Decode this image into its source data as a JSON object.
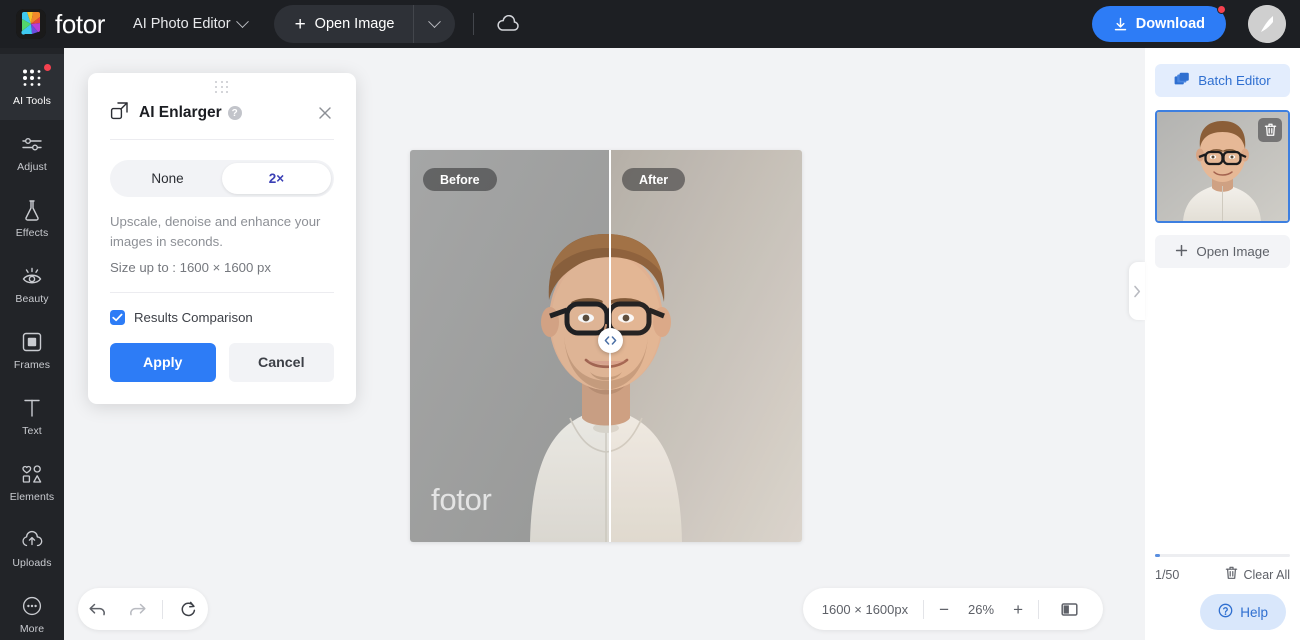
{
  "header": {
    "brand": "fotor",
    "brand_logo_icon": "fotor-pinwheel-logo",
    "app_switcher_label": "AI Photo Editor",
    "app_switcher_icon": "chevron-down-icon",
    "open_image_label": "Open Image",
    "open_image_plus_icon": "plus-icon",
    "open_image_caret_icon": "chevron-down-icon",
    "cloud_icon": "cloud-icon",
    "download_label": "Download",
    "download_icon": "download-icon",
    "download_badge_color": "#f5414f",
    "accent_color": "#2d7cf6",
    "avatar_icon": "user-avatar"
  },
  "sidebar": {
    "items": [
      {
        "label": "AI Tools",
        "icon": "ai-tools-dots-icon",
        "active": true,
        "badge": true
      },
      {
        "label": "Adjust",
        "icon": "sliders-icon",
        "active": false,
        "badge": false
      },
      {
        "label": "Effects",
        "icon": "flask-icon",
        "active": false,
        "badge": false
      },
      {
        "label": "Beauty",
        "icon": "eye-icon",
        "active": false,
        "badge": false
      },
      {
        "label": "Frames",
        "icon": "frame-square-icon",
        "active": false,
        "badge": false
      },
      {
        "label": "Text",
        "icon": "text-t-icon",
        "active": false,
        "badge": false
      },
      {
        "label": "Elements",
        "icon": "shapes-icon",
        "active": false,
        "badge": false
      },
      {
        "label": "Uploads",
        "icon": "upload-cloud-icon",
        "active": false,
        "badge": false
      },
      {
        "label": "More",
        "icon": "more-dots-icon",
        "active": false,
        "badge": false
      }
    ]
  },
  "panel": {
    "title": "AI Enlarger",
    "title_icon": "enlarge-icon",
    "help_icon": "?",
    "close_icon": "close-icon",
    "drag_handle_icon": "drag-dots-icon",
    "options": [
      {
        "label": "None",
        "selected": false
      },
      {
        "label": "2×",
        "selected": true
      }
    ],
    "description": "Upscale, denoise and enhance your images in seconds.",
    "size_note": "Size up to : 1600 × 1600 px",
    "comparison_label": "Results Comparison",
    "comparison_checked": true,
    "checkbox_icon": "checkmark-icon",
    "apply_label": "Apply",
    "cancel_label": "Cancel"
  },
  "canvas": {
    "before_label": "Before",
    "after_label": "After",
    "watermark": "fotor",
    "slider_icon": "left-right-chevrons-icon",
    "split_position_pct": 51
  },
  "bottom_bar": {
    "undo_icon": "undo-arrow-icon",
    "redo_icon": "redo-arrow-icon",
    "reset_icon": "reset-circular-arrow-icon",
    "image_size": "1600 × 1600px",
    "zoom_out_icon": "minus-icon",
    "zoom_level": "26%",
    "zoom_in_icon": "plus-icon",
    "compare_view_icon": "split-view-icon"
  },
  "right_panel": {
    "batch_editor_label": "Batch Editor",
    "batch_editor_icon": "layers-icon",
    "thumbnail_delete_icon": "trash-icon",
    "open_image_label": "Open Image",
    "open_image_icon": "plus-icon",
    "counter": "1/50",
    "clear_all_label": "Clear All",
    "clear_all_icon": "trash-icon",
    "collapse_icon": "chevron-right-icon",
    "help_label": "Help",
    "help_icon": "question-circle-icon",
    "batch_accent_color": "#2f6fd0"
  }
}
